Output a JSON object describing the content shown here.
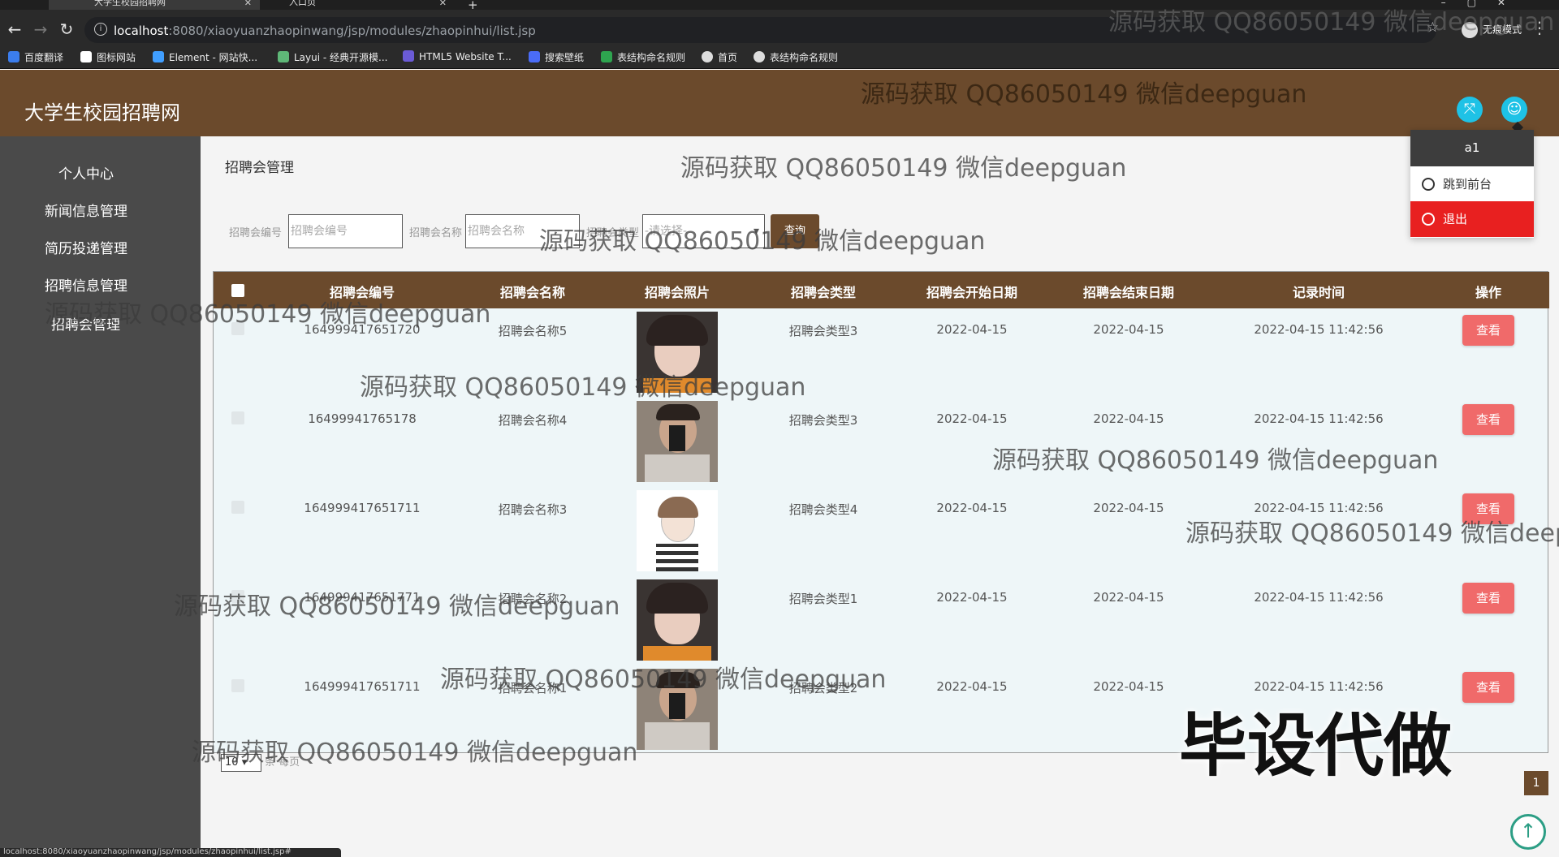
{
  "browser": {
    "tabs": [
      {
        "label": "大学生校园招聘网"
      },
      {
        "label": "入口页"
      }
    ],
    "url_host": "localhost",
    "url_rest": ":8080/xiaoyuanzhaopinwang/jsp/modules/zhaopinhui/list.jsp",
    "incognito_label": "无痕模式",
    "bookmarks": [
      {
        "label": "百度翻译",
        "color": "#3b7ded"
      },
      {
        "label": "图标网站",
        "color": "#ffffff"
      },
      {
        "label": "Element - 网站快...",
        "color": "#409eff"
      },
      {
        "label": "Layui - 经典开源模...",
        "color": "#5fb878"
      },
      {
        "label": "HTML5 Website T...",
        "color": "#6b5bd6"
      },
      {
        "label": "搜索壁纸",
        "color": "#4a6cf7"
      },
      {
        "label": "表结构命名规则",
        "color": "#2ea44f"
      },
      {
        "label": "首页",
        "color": "#dddddd"
      },
      {
        "label": "表结构命名规则",
        "color": "#dddddd"
      }
    ],
    "status_url": "localhost:8080/xiaoyuanzhaopinwang/jsp/modules/zhaopinhui/list.jsp#"
  },
  "app": {
    "title": "大学生校园招聘网",
    "brand_color": "#6b4a2c"
  },
  "sidebar": {
    "items": [
      {
        "label": "个人中心"
      },
      {
        "label": "新闻信息管理"
      },
      {
        "label": "简历投递管理"
      },
      {
        "label": "招聘信息管理"
      },
      {
        "label": "招聘会管理"
      }
    ]
  },
  "page": {
    "title": "招聘会管理",
    "breadcrumb": "I"
  },
  "search": {
    "fields": [
      {
        "label": "招聘会编号",
        "placeholder": "招聘会编号"
      },
      {
        "label": "招聘会名称",
        "placeholder": "招聘会名称"
      },
      {
        "label": "招聘会类型",
        "placeholder": "-请选择-"
      }
    ],
    "button": "查询"
  },
  "table": {
    "columns": [
      "招聘会编号",
      "招聘会名称",
      "招聘会照片",
      "招聘会类型",
      "招聘会开始日期",
      "招聘会结束日期",
      "记录时间",
      "操作"
    ],
    "rows": [
      {
        "id": "164999417651720",
        "name": "招聘会名称5",
        "type": "招聘会类型3",
        "start": "2022-04-15",
        "end": "2022-04-15",
        "time": "2022-04-15 11:42:56",
        "action": "查看"
      },
      {
        "id": "16499941765178",
        "name": "招聘会名称4",
        "type": "招聘会类型3",
        "start": "2022-04-15",
        "end": "2022-04-15",
        "time": "2022-04-15 11:42:56",
        "action": "查看"
      },
      {
        "id": "164999417651711",
        "name": "招聘会名称3",
        "type": "招聘会类型4",
        "start": "2022-04-15",
        "end": "2022-04-15",
        "time": "2022-04-15 11:42:56",
        "action": "查看"
      },
      {
        "id": "164999417651771",
        "name": "招聘会名称2",
        "type": "招聘会类型1",
        "start": "2022-04-15",
        "end": "2022-04-15",
        "time": "2022-04-15 11:42:56",
        "action": "查看"
      },
      {
        "id": "164999417651711",
        "name": "招聘会名称1",
        "type": "招聘会类型2",
        "start": "2022-04-15",
        "end": "2022-04-15",
        "time": "2022-04-15 11:42:56",
        "action": "查看"
      }
    ]
  },
  "pagination": {
    "page_size": "10",
    "page_size_label": "条 每页",
    "current_page": "1"
  },
  "user_menu": {
    "username": "a1",
    "front_label": "跳到前台",
    "logout_label": "退出"
  },
  "watermark": {
    "text": "源码获取 QQ86050149 微信deepguan",
    "big_text": "毕设代做"
  }
}
